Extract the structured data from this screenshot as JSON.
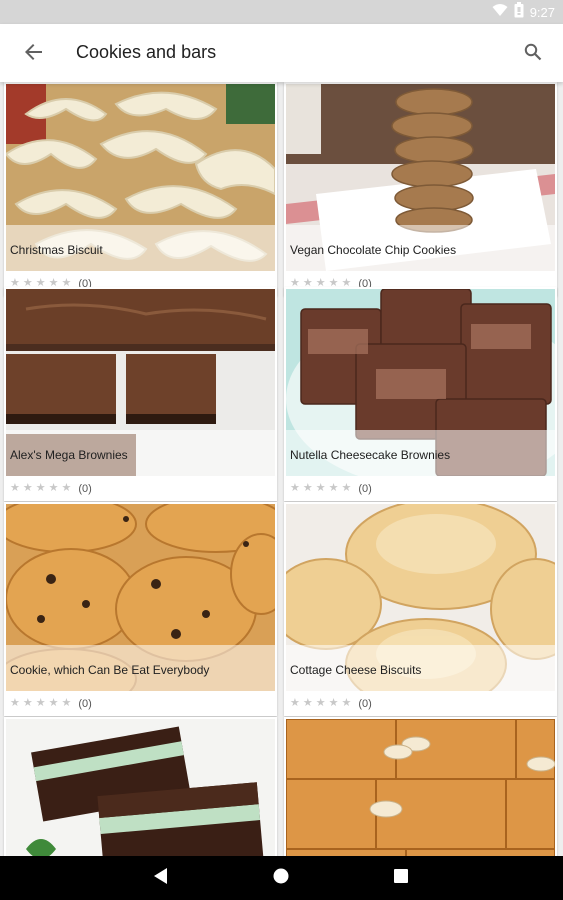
{
  "status_bar": {
    "time": "9:27"
  },
  "app_bar": {
    "title": "Cookies and bars"
  },
  "recipes": [
    {
      "title": "Christmas Biscuit",
      "rating_count": "(0)"
    },
    {
      "title": "Vegan Chocolate Chip Cookies",
      "rating_count": "(0)"
    },
    {
      "title": "Alex's Mega Brownies",
      "rating_count": "(0)"
    },
    {
      "title": "Nutella Cheesecake Brownies",
      "rating_count": "(0)"
    },
    {
      "title": "Cookie, which Can Be Eat Everybody",
      "rating_count": "(0)"
    },
    {
      "title": "Cottage Cheese Biscuits",
      "rating_count": "(0)"
    },
    {
      "title": "",
      "rating_count": ""
    },
    {
      "title": "",
      "rating_count": ""
    }
  ],
  "colors": {
    "app_bar_bg": "#ffffff",
    "page_bg": "#eeeeee",
    "nav_bar_bg": "#000000",
    "star_empty": "#c8c8c8"
  },
  "icons": {
    "back": "arrow-back-icon",
    "search": "search-icon",
    "wifi": "wifi-icon",
    "battery": "battery-icon",
    "nav_back": "triangle-back-icon",
    "nav_home": "circle-home-icon",
    "nav_recents": "square-recents-icon"
  }
}
